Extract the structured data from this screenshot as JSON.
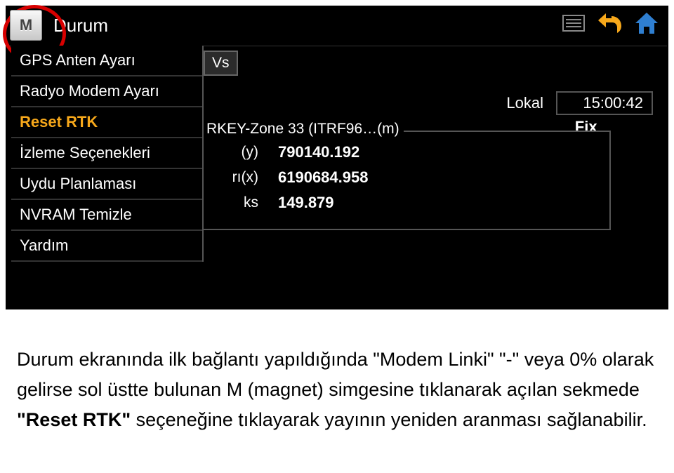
{
  "title": "Durum",
  "m_label": "M",
  "menu": {
    "items": [
      {
        "label": "GPS Anten Ayarı",
        "selected": false
      },
      {
        "label": "Radyo Modem Ayarı",
        "selected": false
      },
      {
        "label": "Reset RTK",
        "selected": true
      },
      {
        "label": "İzleme Seçenekleri",
        "selected": false
      },
      {
        "label": "Uydu Planlaması",
        "selected": false
      },
      {
        "label": "NVRAM Temizle",
        "selected": false
      },
      {
        "label": "Yardım",
        "selected": false
      }
    ]
  },
  "tab_stub": "Vs",
  "status": {
    "lokal_label": "Lokal",
    "time": "15:00:42",
    "fix": "Fix"
  },
  "fieldset": {
    "legend": "RKEY-Zone 33 (ITRF96…(m)",
    "rows": [
      {
        "label_frag": "(y)",
        "value": "790140.192"
      },
      {
        "label_frag": "rı(x)",
        "value": "6190684.958"
      },
      {
        "label_frag": "ks",
        "value": "149.879"
      }
    ]
  },
  "caption": {
    "p1_a": "Durum ekranında ilk bağlantı yapıldığında \"Modem Linki\" \"-\" veya  0% olarak gelirse sol üstte bulunan M (magnet) simgesine tıklanarak açılan sekmede ",
    "p1_bold": "\"Reset RTK\"",
    "p1_b": " seçeneğine tıklayarak yayının yeniden aranması sağlanabilir."
  }
}
